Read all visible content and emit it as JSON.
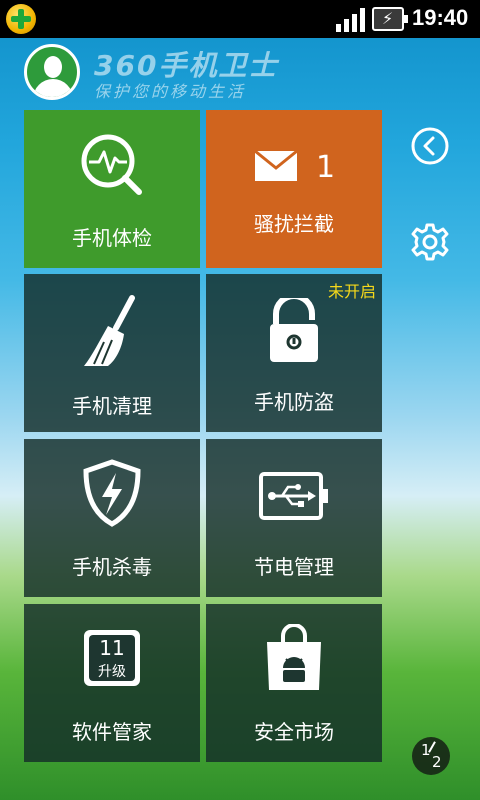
{
  "status_bar": {
    "time": "19:40"
  },
  "header": {
    "brand": "360手机卫士",
    "slogan": "保护您的移动生活"
  },
  "tiles": [
    {
      "label": "手机体检",
      "icon": "health-check-icon"
    },
    {
      "label": "骚扰拦截",
      "icon": "envelope-icon",
      "count": "1"
    },
    {
      "label": "手机清理",
      "icon": "broom-icon"
    },
    {
      "label": "手机防盗",
      "icon": "unlocked-padlock-icon",
      "status": "未开启"
    },
    {
      "label": "手机杀毒",
      "icon": "shield-lightning-icon"
    },
    {
      "label": "节电管理",
      "icon": "usb-battery-icon"
    },
    {
      "label": "软件管家",
      "icon": "app-update-icon",
      "update_count": "11",
      "update_text": "升级"
    },
    {
      "label": "安全市场",
      "icon": "shopping-bag-android-icon"
    }
  ],
  "side": {
    "back": "back-circle-icon",
    "settings": "gear-icon"
  },
  "pager": {
    "current": "1",
    "total": "2"
  },
  "colors": {
    "green_tile": "#3f9b2c",
    "orange_tile": "#d0641e",
    "dark_tile": "#1e3630",
    "warning": "#f5d81a"
  }
}
